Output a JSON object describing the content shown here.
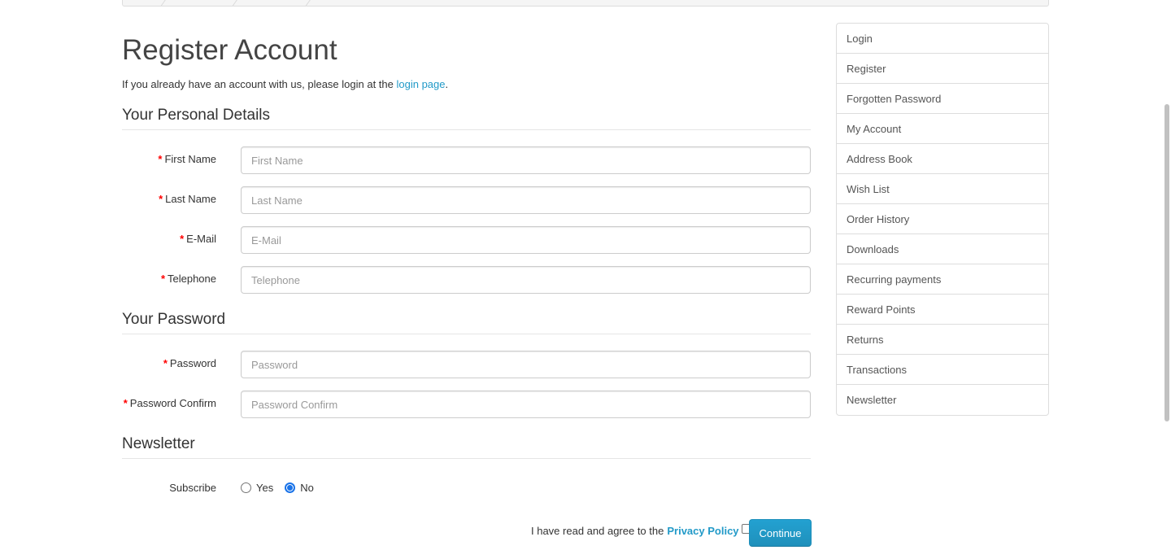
{
  "page": {
    "title": "Register Account",
    "intro_text": "If you already have an account with us, please login at the ",
    "intro_link": "login page",
    "intro_end": "."
  },
  "sections": {
    "personal": "Your Personal Details",
    "password": "Your Password",
    "newsletter": "Newsletter"
  },
  "required_mark": "*",
  "fields": {
    "firstname": {
      "label": "First Name",
      "placeholder": "First Name"
    },
    "lastname": {
      "label": "Last Name",
      "placeholder": "Last Name"
    },
    "email": {
      "label": "E-Mail",
      "placeholder": "E-Mail"
    },
    "telephone": {
      "label": "Telephone",
      "placeholder": "Telephone"
    },
    "password": {
      "label": "Password",
      "placeholder": "Password"
    },
    "confirm": {
      "label": "Password Confirm",
      "placeholder": "Password Confirm"
    }
  },
  "subscribe": {
    "label": "Subscribe",
    "yes": "Yes",
    "no": "No",
    "selected": "No"
  },
  "agree": {
    "text": "I have read and agree to the",
    "link": "Privacy Policy",
    "checked": false
  },
  "continue_label": "Continue",
  "sidebar": {
    "items": [
      {
        "label": "Login"
      },
      {
        "label": "Register"
      },
      {
        "label": "Forgotten Password"
      },
      {
        "label": "My Account"
      },
      {
        "label": "Address Book"
      },
      {
        "label": "Wish List"
      },
      {
        "label": "Order History"
      },
      {
        "label": "Downloads"
      },
      {
        "label": "Recurring payments"
      },
      {
        "label": "Reward Points"
      },
      {
        "label": "Returns"
      },
      {
        "label": "Transactions"
      },
      {
        "label": "Newsletter"
      }
    ]
  },
  "colors": {
    "link": "#229ac8",
    "button": "#23a1d1",
    "required": "#ff0000"
  }
}
